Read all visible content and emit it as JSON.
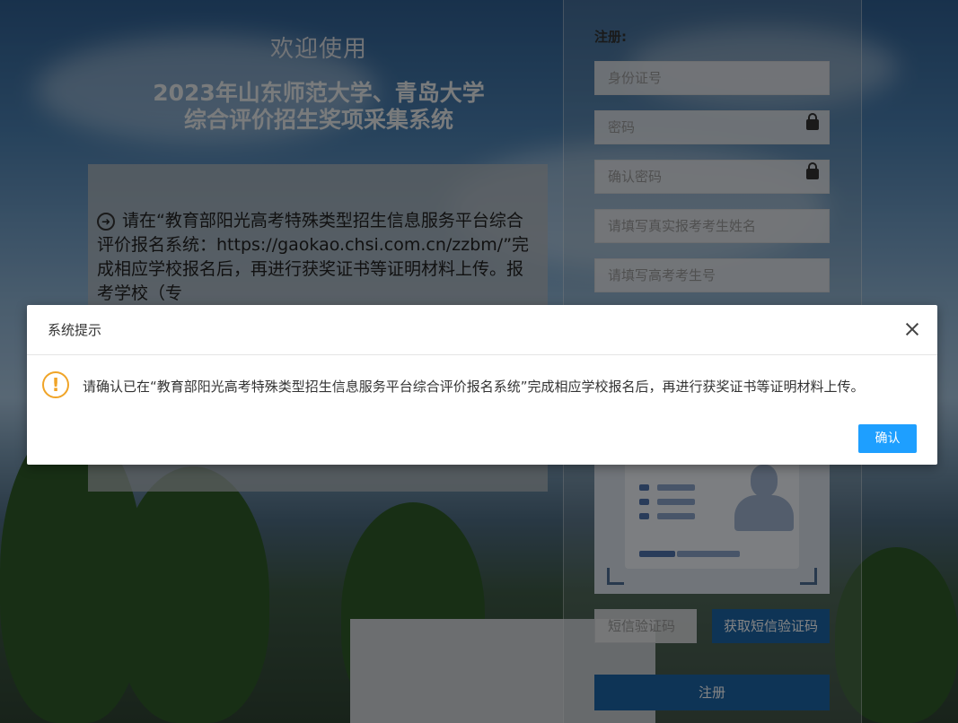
{
  "welcome": {
    "hello": "欢迎使用",
    "title_line1": "2023年山东师范大学、青岛大学",
    "title_line2": "综合评价招生奖项采集系统"
  },
  "notice": {
    "text": "请在“教育部阳光高考特殊类型招生信息服务平台综合评价报名系统：https://gaokao.chsi.com.cn/zzbm/”完成相应学校报名后，再进行获奖证书等证明材料上传。报考学校（专"
  },
  "register": {
    "title": "注册:",
    "id_placeholder": "身份证号",
    "password_placeholder": "密码",
    "confirm_placeholder": "确认密码",
    "name_placeholder": "请填写真实报考考生姓名",
    "exam_no_placeholder": "请填写高考考生号",
    "sms_placeholder": "短信验证码",
    "sms_button": "获取短信验证码",
    "submit_button": "注册"
  },
  "modal": {
    "title": "系统提示",
    "message": "请确认已在“教育部阳光高考特殊类型招生信息服务平台综合评价报名系统”完成相应学校报名后，再进行获奖证书等证明材料上传。",
    "ok_button": "确认"
  },
  "colors": {
    "primary_button": "#1b64a6",
    "modal_button": "#1e9fff",
    "warning": "#f0a427"
  }
}
